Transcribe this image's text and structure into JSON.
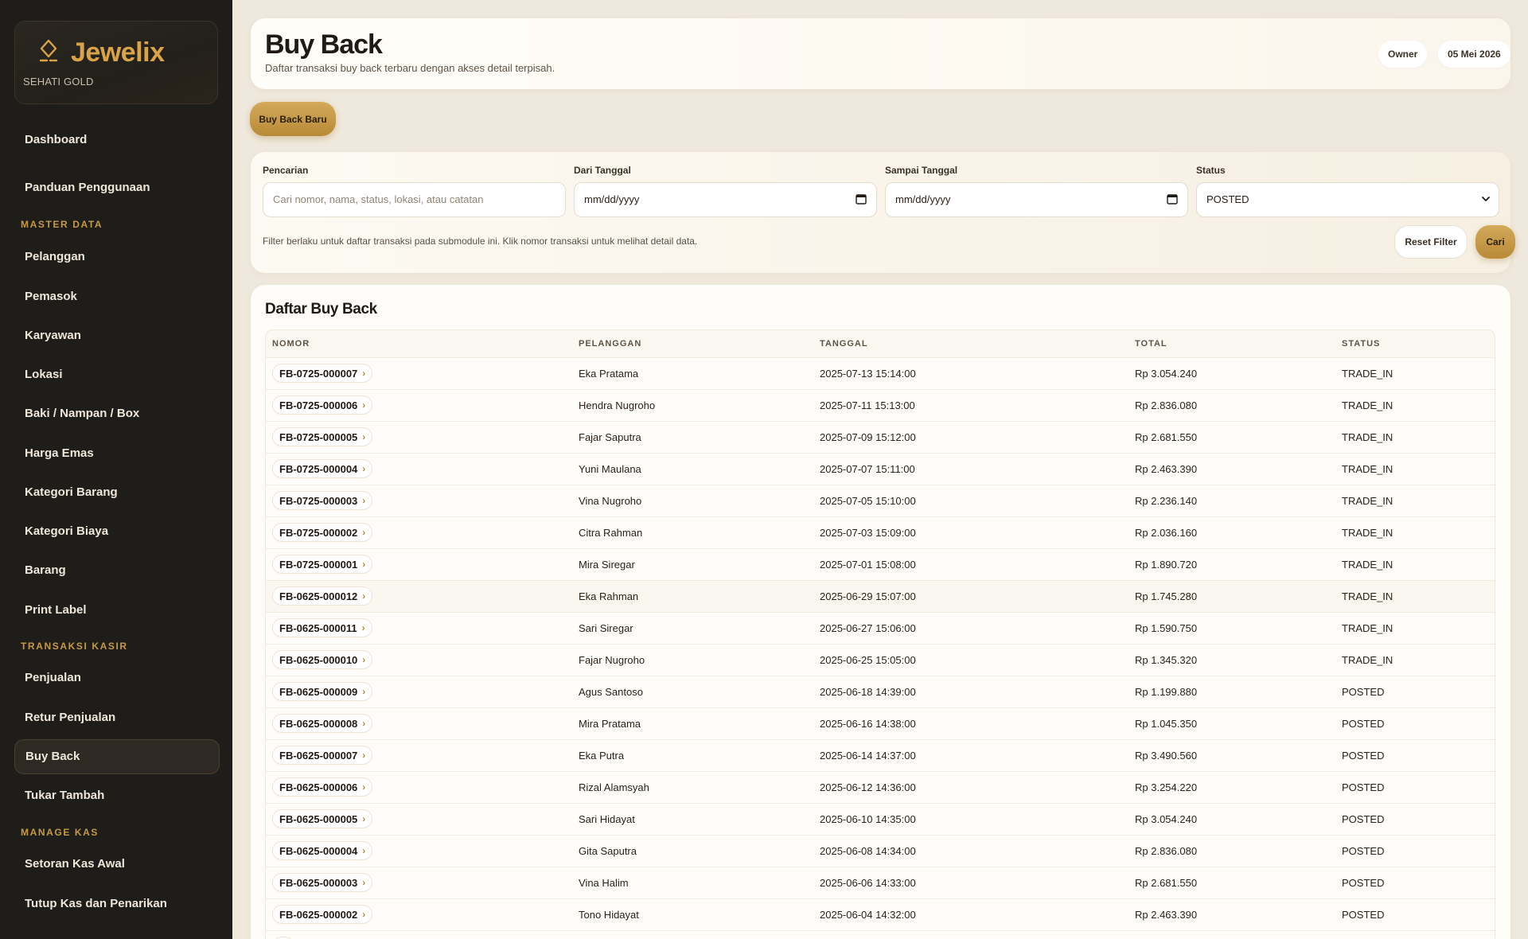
{
  "brand": {
    "name": "Jewelix",
    "subtitle": "SEHATI GOLD"
  },
  "sidebar": {
    "items": [
      {
        "label": "Dashboard",
        "section": null
      },
      {
        "label": "Panduan Penggunaan",
        "section": null
      },
      {
        "label": "Pelanggan",
        "section": "MASTER DATA"
      },
      {
        "label": "Pemasok"
      },
      {
        "label": "Karyawan"
      },
      {
        "label": "Lokasi"
      },
      {
        "label": "Baki / Nampan / Box"
      },
      {
        "label": "Harga Emas"
      },
      {
        "label": "Kategori Barang"
      },
      {
        "label": "Kategori Biaya"
      },
      {
        "label": "Barang"
      },
      {
        "label": "Print Label"
      },
      {
        "label": "Penjualan",
        "section": "TRANSAKSI KASIR"
      },
      {
        "label": "Retur Penjualan"
      },
      {
        "label": "Buy Back",
        "active": true
      },
      {
        "label": "Tukar Tambah"
      },
      {
        "label": "Setoran Kas Awal",
        "section": "MANAGE KAS"
      },
      {
        "label": "Tutup Kas dan Penarikan"
      }
    ],
    "sections": [
      "MASTER DATA",
      "TRANSAKSI KASIR",
      "MANAGE KAS"
    ]
  },
  "header": {
    "title": "Buy Back",
    "subtitle": "Daftar transaksi buy back terbaru dengan akses detail terpisah.",
    "role": "Owner",
    "date": "05 Mei 2026"
  },
  "actions": {
    "new_label": "Buy Back Baru"
  },
  "filter": {
    "search_label": "Pencarian",
    "search_placeholder": "Cari nomor, nama, status, lokasi, atau catatan",
    "from_label": "Dari Tanggal",
    "from_value": "mm/dd/yyyy",
    "to_label": "Sampai Tanggal",
    "to_value": "mm/dd/yyyy",
    "status_label": "Status",
    "status_value": "POSTED",
    "note": "Filter berlaku untuk daftar transaksi pada submodule ini. Klik nomor transaksi untuk melihat detail data.",
    "reset_label": "Reset Filter",
    "search_button_label": "Cari"
  },
  "table": {
    "title": "Daftar Buy Back",
    "columns": [
      "NOMOR",
      "PELANGGAN",
      "TANGGAL",
      "TOTAL",
      "STATUS"
    ],
    "rows": [
      [
        "FB-0725-000007",
        "Eka Pratama",
        "2025-07-13 15:14:00",
        "Rp 3.054.240",
        "TRADE_IN"
      ],
      [
        "FB-0725-000006",
        "Hendra Nugroho",
        "2025-07-11 15:13:00",
        "Rp 2.836.080",
        "TRADE_IN"
      ],
      [
        "FB-0725-000005",
        "Fajar Saputra",
        "2025-07-09 15:12:00",
        "Rp 2.681.550",
        "TRADE_IN"
      ],
      [
        "FB-0725-000004",
        "Yuni Maulana",
        "2025-07-07 15:11:00",
        "Rp 2.463.390",
        "TRADE_IN"
      ],
      [
        "FB-0725-000003",
        "Vina Nugroho",
        "2025-07-05 15:10:00",
        "Rp 2.236.140",
        "TRADE_IN"
      ],
      [
        "FB-0725-000002",
        "Citra Rahman",
        "2025-07-03 15:09:00",
        "Rp 2.036.160",
        "TRADE_IN"
      ],
      [
        "FB-0725-000001",
        "Mira Siregar",
        "2025-07-01 15:08:00",
        "Rp 1.890.720",
        "TRADE_IN"
      ],
      [
        "FB-0625-000012",
        "Eka Rahman",
        "2025-06-29 15:07:00",
        "Rp 1.745.280",
        "TRADE_IN"
      ],
      [
        "FB-0625-000011",
        "Sari Siregar",
        "2025-06-27 15:06:00",
        "Rp 1.590.750",
        "TRADE_IN"
      ],
      [
        "FB-0625-000010",
        "Fajar Nugroho",
        "2025-06-25 15:05:00",
        "Rp 1.345.320",
        "TRADE_IN"
      ],
      [
        "FB-0625-000009",
        "Agus Santoso",
        "2025-06-18 14:39:00",
        "Rp 1.199.880",
        "POSTED"
      ],
      [
        "FB-0625-000008",
        "Mira Pratama",
        "2025-06-16 14:38:00",
        "Rp 1.045.350",
        "POSTED"
      ],
      [
        "FB-0625-000007",
        "Eka Putra",
        "2025-06-14 14:37:00",
        "Rp 3.490.560",
        "POSTED"
      ],
      [
        "FB-0625-000006",
        "Rizal Alamsyah",
        "2025-06-12 14:36:00",
        "Rp 3.254.220",
        "POSTED"
      ],
      [
        "FB-0625-000005",
        "Sari Hidayat",
        "2025-06-10 14:35:00",
        "Rp 3.054.240",
        "POSTED"
      ],
      [
        "FB-0625-000004",
        "Gita Saputra",
        "2025-06-08 14:34:00",
        "Rp 2.836.080",
        "POSTED"
      ],
      [
        "FB-0625-000003",
        "Vina Halim",
        "2025-06-06 14:33:00",
        "Rp 2.681.550",
        "POSTED"
      ],
      [
        "FB-0625-000002",
        "Tono Hidayat",
        "2025-06-04 14:32:00",
        "Rp 2.463.390",
        "POSTED"
      ],
      [
        "",
        "",
        "",
        "",
        ""
      ]
    ]
  },
  "colors": {
    "accent": "#c99a45",
    "sidebar_bg": "#1f1d1a",
    "page_bg": "#efe8dc"
  },
  "icons": {
    "logo": "diamond-logo-icon",
    "calendar": "calendar-icon",
    "select": "chevron-down-icon",
    "row_link": "chevron-right-icon"
  }
}
